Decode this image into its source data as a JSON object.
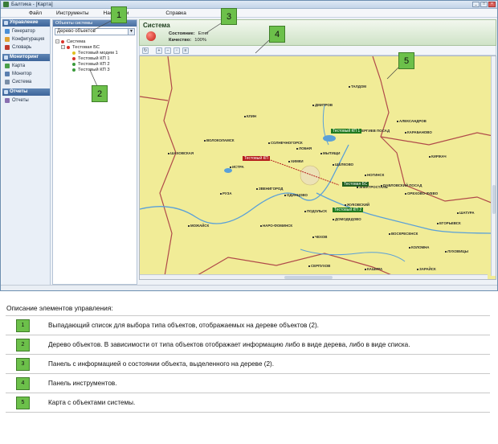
{
  "window": {
    "title": "Балтика - [Карта]",
    "controls": [
      "_",
      "□",
      "×"
    ]
  },
  "menu": [
    "Файл",
    "Инструменты",
    "Настройки",
    "Справка"
  ],
  "nav": {
    "groups": [
      {
        "label": "Управление",
        "items": [
          {
            "label": "Генератор",
            "icon": "generator-icon",
            "color": "#4a8fd6"
          },
          {
            "label": "Конфигурация",
            "icon": "config-icon",
            "color": "#e0a030"
          },
          {
            "label": "Словарь",
            "icon": "dictionary-icon",
            "color": "#c0392b"
          }
        ]
      },
      {
        "label": "Мониторинг",
        "items": [
          {
            "label": "Карта",
            "icon": "map-icon",
            "color": "#4aa04a"
          },
          {
            "label": "Монитор",
            "icon": "monitor-icon",
            "color": "#5a7fb0"
          },
          {
            "label": "Система",
            "icon": "system-icon",
            "color": "#7a8fa8"
          }
        ]
      },
      {
        "label": "Отчеты",
        "items": [
          {
            "label": "Отчеты",
            "icon": "reports-icon",
            "color": "#8a6fb0"
          }
        ]
      }
    ]
  },
  "object_panel": {
    "header": "Объекты системы",
    "select_value": "Дерево объектов",
    "tree": [
      {
        "label": "Система",
        "level": 0,
        "expander": "−",
        "dot": "#d9322a"
      },
      {
        "label": "Тестовая БС",
        "level": 1,
        "expander": "−",
        "dot": "#d9322a"
      },
      {
        "label": "Тестовый модем 1",
        "level": 2,
        "expander": "",
        "dot": "#e0c020"
      },
      {
        "label": "Тестовый КП 1",
        "level": 2,
        "expander": "",
        "dot": "#d9322a"
      },
      {
        "label": "Тестовый КП 2",
        "level": 2,
        "expander": "",
        "dot": "#3a9a3a"
      },
      {
        "label": "Тестовый КП 3",
        "level": 2,
        "expander": "",
        "dot": "#3a9a3a"
      }
    ]
  },
  "status_panel": {
    "name": "Система",
    "state_label": "Состояние:",
    "state_value": "Error",
    "quality_label": "Качество:",
    "quality_value": "100%"
  },
  "toolbar": [
    "refresh-icon",
    "zoom-in-icon",
    "zoom-out-icon",
    "zoom-fit-icon",
    "layers-icon"
  ],
  "map": {
    "cities": [
      {
        "name": "КЛИН"
      },
      {
        "name": "ДМИТРОВ"
      },
      {
        "name": "ТАЛДОМ"
      },
      {
        "name": "СЕРГИЕВ ПОСАД"
      },
      {
        "name": "АЛЕКСАНДРОВ"
      },
      {
        "name": "КИРЖАЧ"
      },
      {
        "name": "СОЛНЕЧНОГОРСК"
      },
      {
        "name": "ВОЛОКОЛАМСК"
      },
      {
        "name": "ШАХОВСКАЯ"
      },
      {
        "name": "ИСТРА"
      },
      {
        "name": "ХИМКИ"
      },
      {
        "name": "МЫТИЩИ"
      },
      {
        "name": "ЩЁЛКОВО"
      },
      {
        "name": "НОГИНСК"
      },
      {
        "name": "ЭЛЕКТРОСТАЛЬ"
      },
      {
        "name": "ОРЕХОВО-ЗУЕВО"
      },
      {
        "name": "ПАВЛОВСКИЙ ПОСАД"
      },
      {
        "name": "РУЗА"
      },
      {
        "name": "ЗВЕНИГОРОД"
      },
      {
        "name": "ОДИНЦОВО"
      },
      {
        "name": "МОЖАЙСК"
      },
      {
        "name": "НАРО-ФОМИНСК"
      },
      {
        "name": "ПОДОЛЬСК"
      },
      {
        "name": "ДОМОДЕДОВО"
      },
      {
        "name": "ВОСКРЕСЕНСК"
      },
      {
        "name": "КОЛОМНА"
      },
      {
        "name": "ЧЕХОВ"
      },
      {
        "name": "СЕРПУХОВ"
      },
      {
        "name": "КАШИРА"
      },
      {
        "name": "ЗАРАЙСК"
      },
      {
        "name": "ШАТУРА"
      },
      {
        "name": "ЕГОРЬЕВСК"
      },
      {
        "name": "ЛУХОВИЦЫ"
      },
      {
        "name": "КАРАБАНОВО"
      },
      {
        "name": "ЛОБНЯ"
      },
      {
        "name": "ЖУКОВСКИЙ"
      }
    ],
    "objects": [
      {
        "label": "Тестовый КП 1",
        "color": "#1f7a1f"
      },
      {
        "label": "Тестовый КП",
        "color": "#b51c1c"
      },
      {
        "label": "Тестовая БС",
        "color": "#1f5f1f"
      },
      {
        "label": "Тестовый КП 2",
        "color": "#1f7a1f"
      }
    ]
  },
  "callouts": [
    "1",
    "2",
    "3",
    "4",
    "5"
  ],
  "description": {
    "title": "Описание элементов управления:",
    "rows": [
      {
        "num": "1",
        "text": "Выпадающий список для выбора типа объектов, отображаемых на дереве объектов (2)."
      },
      {
        "num": "2",
        "text": "Дерево объектов. В зависимости от типа объектов отображает информацию либо в виде дерева, либо в виде списка."
      },
      {
        "num": "3",
        "text": "Панель с информацией о состоянии объекта, выделенного на дереве (2)."
      },
      {
        "num": "4",
        "text": "Панель инструментов."
      },
      {
        "num": "5",
        "text": "Карта с объектами системы."
      }
    ]
  },
  "colors": {
    "accent_green": "#6cc04a",
    "map_fill": "#f1ec97",
    "nav_header": "#4a6fa0"
  }
}
